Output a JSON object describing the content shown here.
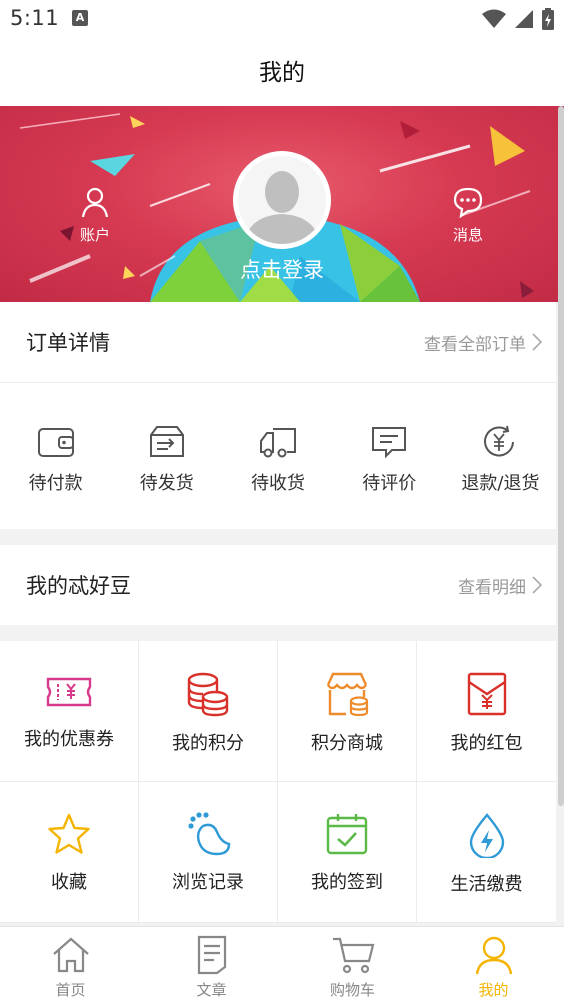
{
  "status": {
    "time": "5:11",
    "notif": "A"
  },
  "title": "我的",
  "banner": {
    "account_label": "账户",
    "message_label": "消息",
    "login_label": "点击登录"
  },
  "orders": {
    "title": "订单详情",
    "view_all": "查看全部订单",
    "items": [
      {
        "label": "待付款",
        "icon": "wallet-icon"
      },
      {
        "label": "待发货",
        "icon": "shipping-box-icon"
      },
      {
        "label": "待收货",
        "icon": "delivery-truck-icon"
      },
      {
        "label": "待评价",
        "icon": "comment-icon"
      },
      {
        "label": "退款/退货",
        "icon": "refund-icon"
      }
    ]
  },
  "beans": {
    "title": "我的忒好豆",
    "detail": "查看明细"
  },
  "services": [
    {
      "label": "我的优惠券",
      "icon": "coupon-icon",
      "color": "#d63a8a"
    },
    {
      "label": "我的积分",
      "icon": "coins-icon",
      "color": "#d9302a"
    },
    {
      "label": "积分商城",
      "icon": "store-icon",
      "color": "#ee8b2c"
    },
    {
      "label": "我的红包",
      "icon": "red-envelope-icon",
      "color": "#d9302a"
    },
    {
      "label": "收藏",
      "icon": "star-icon",
      "color": "#f4b400"
    },
    {
      "label": "浏览记录",
      "icon": "footprint-icon",
      "color": "#2e9ad6"
    },
    {
      "label": "我的签到",
      "icon": "calendar-check-icon",
      "color": "#5bb947"
    },
    {
      "label": "生活缴费",
      "icon": "water-bolt-icon",
      "color": "#2e9ad6"
    }
  ],
  "tabs": [
    {
      "label": "首页",
      "icon": "home-icon"
    },
    {
      "label": "文章",
      "icon": "document-icon"
    },
    {
      "label": "购物车",
      "icon": "cart-icon"
    },
    {
      "label": "我的",
      "icon": "user-icon",
      "active": true
    }
  ],
  "colors": {
    "accent": "#f4b400",
    "banner": "#d63a52"
  }
}
